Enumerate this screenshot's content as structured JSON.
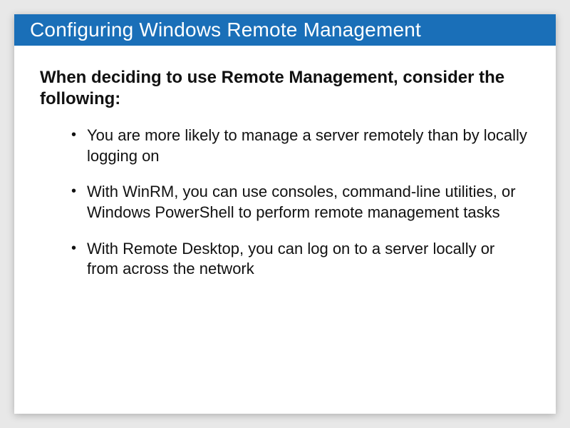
{
  "title": "Configuring Windows Remote Management",
  "intro": "When deciding to use Remote Management, consider the following:",
  "bullets": [
    "You are more likely to manage a server remotely than by locally logging on",
    "With WinRM, you can use consoles, command-line utilities, or Windows PowerShell to perform remote management tasks",
    "With Remote Desktop, you can log on to a server locally or from across the network"
  ]
}
